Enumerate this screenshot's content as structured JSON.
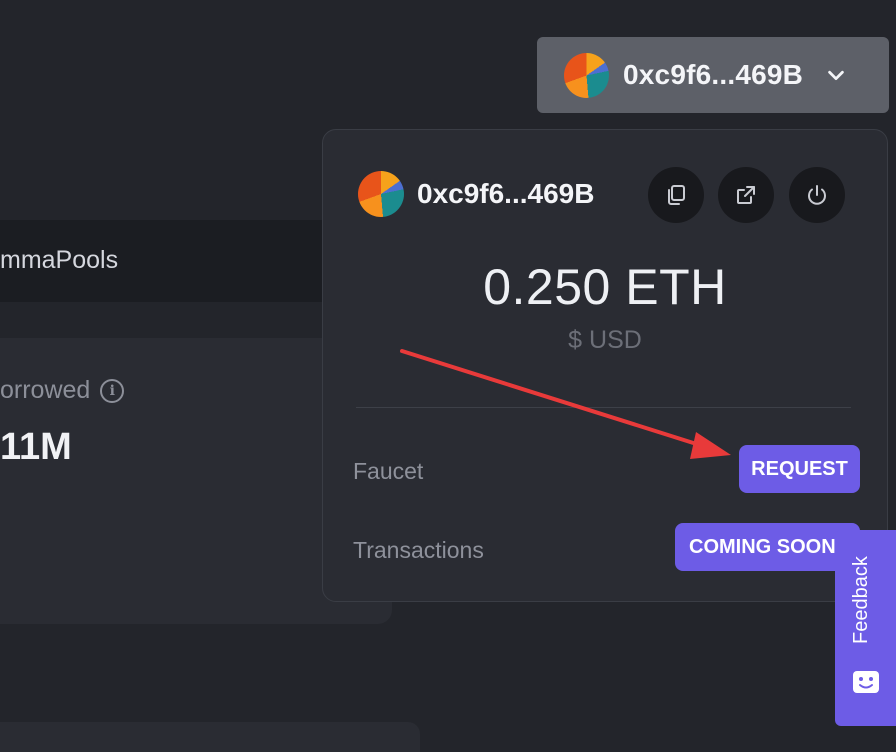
{
  "background": {
    "tab_label": "mmaPools",
    "stat_label": "orrowed",
    "stat_value": "11M"
  },
  "wallet_button": {
    "address": "0xc9f6...469B",
    "avatar_icon": "jazzicon-avatar",
    "chevron_icon": "chevron-down-icon"
  },
  "dropdown": {
    "address": "0xc9f6...469B",
    "actions": [
      {
        "icon": "copy-icon"
      },
      {
        "icon": "external-link-icon"
      },
      {
        "icon": "power-icon"
      }
    ],
    "balance": "0.250 ETH",
    "balance_usd": "$ USD",
    "rows": [
      {
        "label": "Faucet",
        "action": "REQUEST"
      },
      {
        "label": "Transactions",
        "action": "COMING SOON"
      }
    ]
  },
  "feedback": {
    "label": "Feedback",
    "icon": "smiley-chat-icon"
  },
  "colors": {
    "background": "#23252b",
    "panel": "#2a2c33",
    "accent": "#6d5ce6",
    "annotation_arrow": "#e83a3a"
  }
}
